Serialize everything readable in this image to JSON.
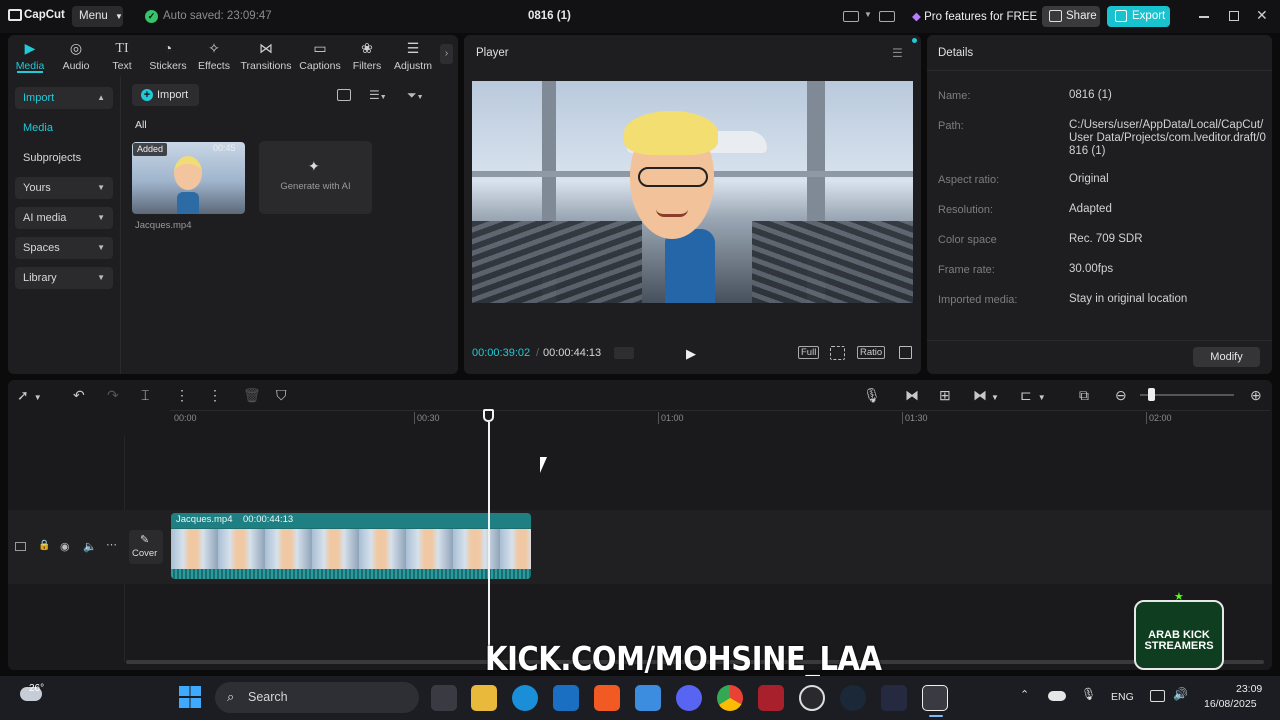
{
  "app": {
    "brand": "CapCut",
    "menu_label": "Menu",
    "autosave": "Auto saved: 23:09:47",
    "project_title": "0816 (1)",
    "pro_label": "Pro features for FREE",
    "share_label": "Share",
    "export_label": "Export"
  },
  "tabs": [
    {
      "label": "Media",
      "icon": "media-icon"
    },
    {
      "label": "Audio",
      "icon": "audio-icon"
    },
    {
      "label": "Text",
      "icon": "text-icon"
    },
    {
      "label": "Stickers",
      "icon": "stickers-icon"
    },
    {
      "label": "Effects",
      "icon": "effects-icon"
    },
    {
      "label": "Transitions",
      "icon": "transitions-icon"
    },
    {
      "label": "Captions",
      "icon": "captions-icon"
    },
    {
      "label": "Filters",
      "icon": "filters-icon"
    },
    {
      "label": "Adjustm",
      "icon": "adjustment-icon"
    }
  ],
  "sidebar": {
    "import": "Import",
    "media": "Media",
    "subprojects": "Subprojects",
    "yours": "Yours",
    "ai_media": "AI media",
    "spaces": "Spaces",
    "library": "Library"
  },
  "media": {
    "import_button": "Import",
    "filter_all": "All",
    "clip_badge": "Added",
    "clip_duration": "00:45",
    "clip_name": "Jacques.mp4",
    "generate_ai": "Generate with AI"
  },
  "player": {
    "title": "Player",
    "current_time": "00:00:39:02",
    "total_time": "00:00:44:13",
    "full_label": "Full",
    "ratio_label": "Ratio"
  },
  "details": {
    "title": "Details",
    "name_label": "Name:",
    "name_value": "0816 (1)",
    "path_label": "Path:",
    "path_value": "C:/Users/user/AppData/Local/CapCut/User Data/Projects/com.lveditor.draft/0816 (1)",
    "aspect_label": "Aspect ratio:",
    "aspect_value": "Original",
    "resolution_label": "Resolution:",
    "resolution_value": "Adapted",
    "colorspace_label": "Color space",
    "colorspace_value": "Rec. 709 SDR",
    "framerate_label": "Frame rate:",
    "framerate_value": "30.00fps",
    "imported_label": "Imported media:",
    "imported_value": "Stay in original location",
    "modify_button": "Modify"
  },
  "timeline": {
    "ticks": [
      "00:00",
      "00:30",
      "01:00",
      "01:30",
      "02:00"
    ],
    "clip_name": "Jacques.mp4",
    "clip_duration": "00:00:44:13",
    "cover_label": "Cover"
  },
  "overlay": {
    "kick_text": "KICK.COM/MOHSINE_LAA",
    "logo_text": "ARAB KICK STREAMERS"
  },
  "taskbar": {
    "weather": "26°",
    "search": "Search",
    "lang": "ENG",
    "time": "23:09",
    "date": "16/08/2025"
  },
  "colors": {
    "accent": "#22c9d6",
    "kick_green": "#53fc18",
    "background": "#0b0b0c",
    "panel": "#1e1e20"
  }
}
